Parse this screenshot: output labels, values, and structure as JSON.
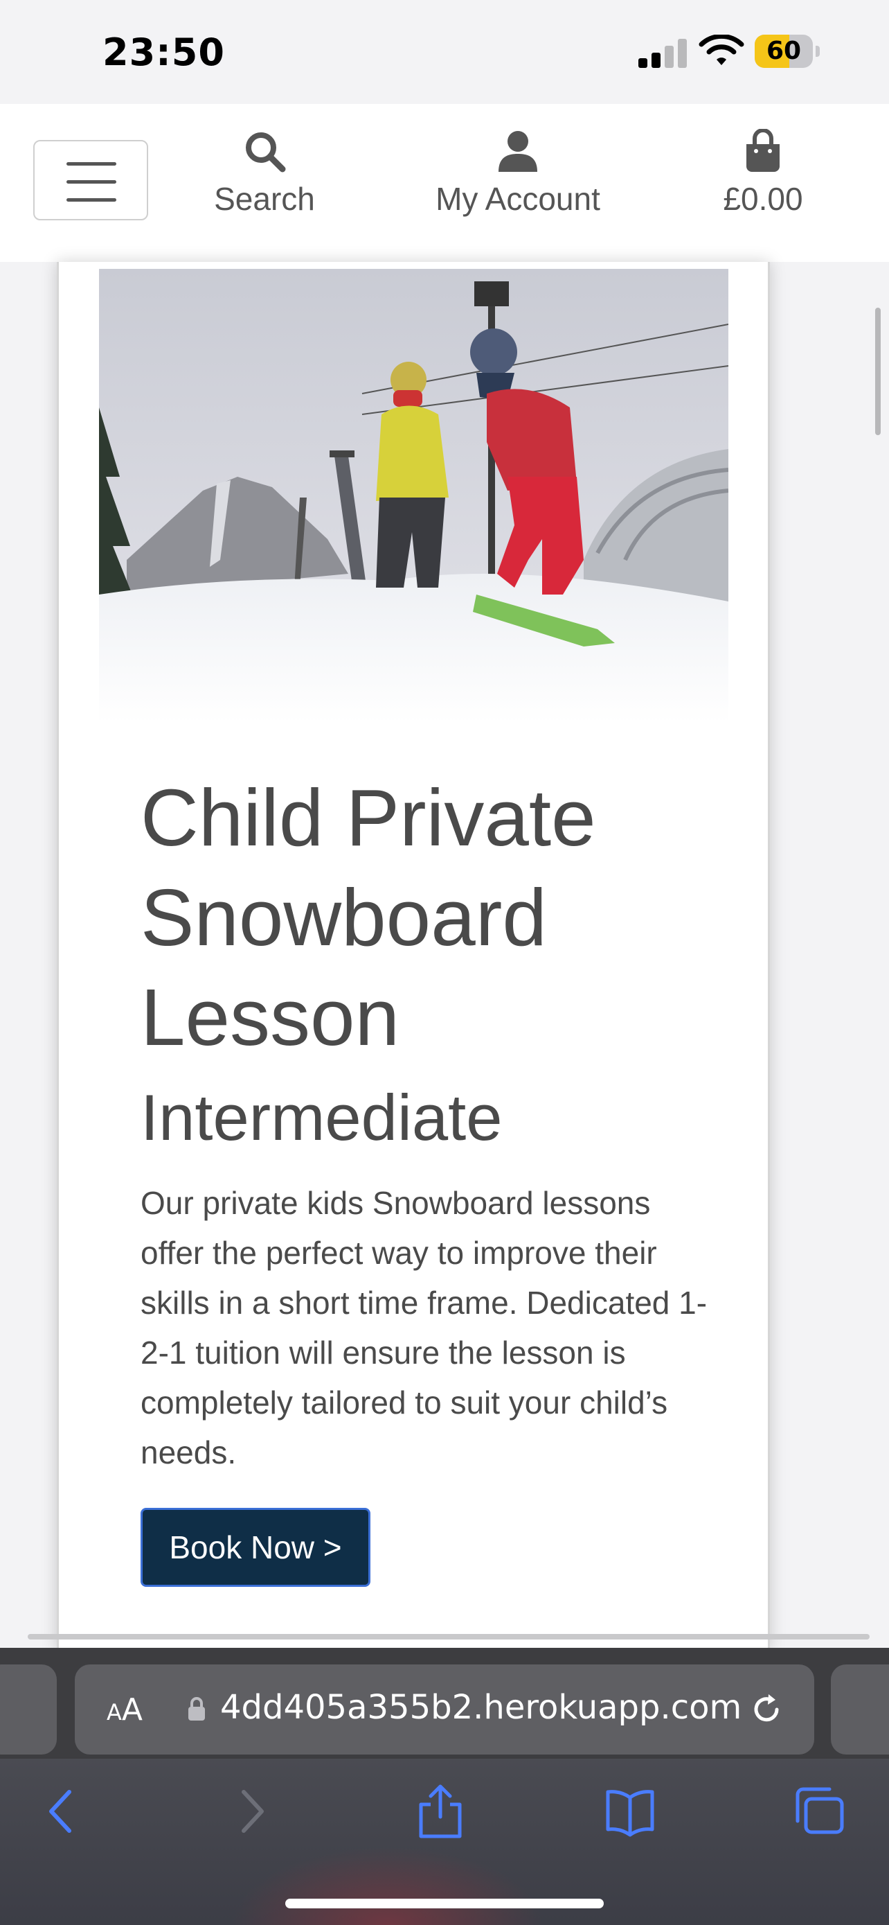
{
  "status_bar": {
    "time": "23:50",
    "battery_level": "60",
    "battery_percent": 60,
    "icons": [
      "cellular-signal-icon",
      "wifi-icon",
      "battery-icon"
    ]
  },
  "header": {
    "menu_icon": "hamburger-menu-icon",
    "search": {
      "label": "Search",
      "icon": "magnifier-icon"
    },
    "account": {
      "label": "My Account",
      "icon": "user-icon"
    },
    "bag": {
      "label": "£0.00",
      "icon": "shopping-bag-icon"
    }
  },
  "product": {
    "image": "photo of two children snowboarding on a snowy ski slope with chairlift towers",
    "title": "Child Private Snowboard Lesson",
    "level": "Intermediate",
    "description": "Our private kids Snowboard lessons offer the perfect way to improve their skills in a short time frame. Dedicated 1-2-1 tuition will ensure the lesson is completely tailored to suit your child’s needs.",
    "button_label": "Book Now >"
  },
  "browser": {
    "aa_label": "AA",
    "url": "4dd405a355b2.herokuapp.com",
    "toolbar_icons": [
      "back-icon",
      "forward-icon",
      "share-icon",
      "bookmarks-icon",
      "tabs-icon"
    ]
  },
  "colors": {
    "button_bg": "#0f2e47",
    "button_border": "#3b6fd6",
    "text": "#4a4a4a",
    "battery": "#f5c518",
    "toolbar_accent": "#4a7dff"
  }
}
